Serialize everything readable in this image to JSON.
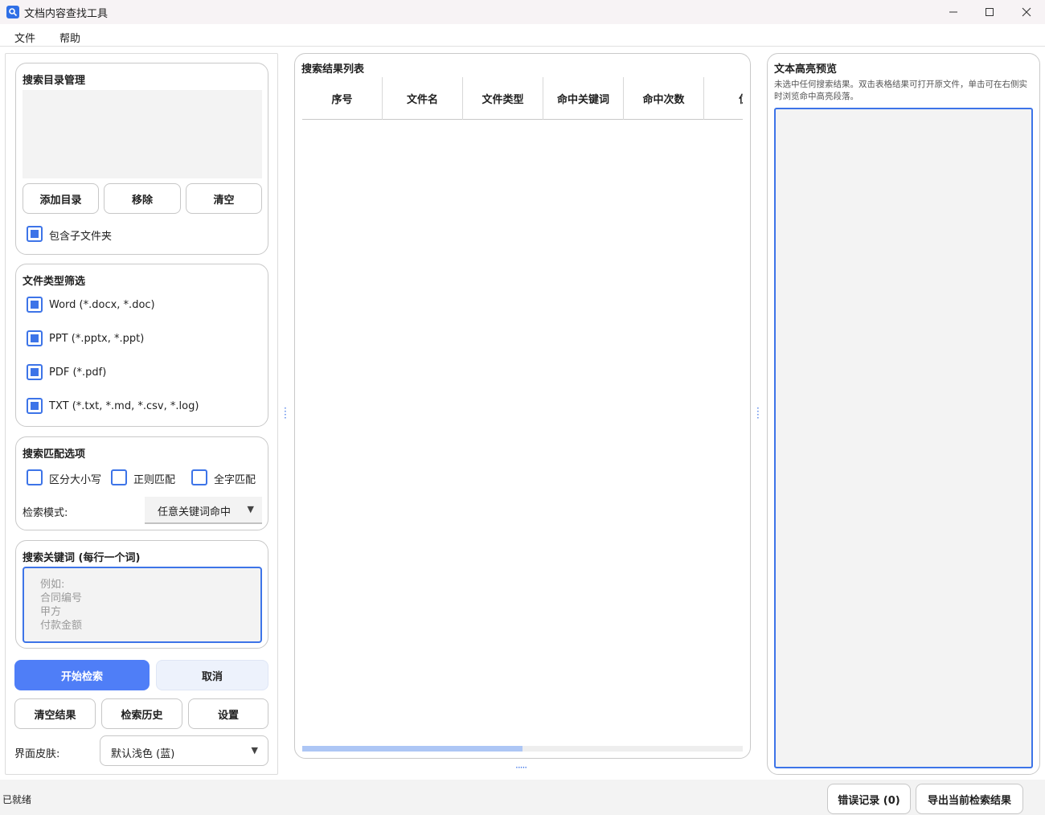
{
  "window": {
    "title": "文档内容查找工具"
  },
  "menu": {
    "file": "文件",
    "help": "帮助"
  },
  "dir_group": {
    "title": "搜索目录管理",
    "add_label": "添加目录",
    "remove_label": "移除",
    "clear_label": "清空",
    "include_sub_label": "包含子文件夹",
    "include_sub_checked": true
  },
  "filetype_group": {
    "title": "文件类型筛选",
    "items": [
      {
        "label": "Word (*.docx, *.doc)",
        "checked": true
      },
      {
        "label": "PPT (*.pptx, *.ppt)",
        "checked": true
      },
      {
        "label": "PDF (*.pdf)",
        "checked": true
      },
      {
        "label": "TXT (*.txt, *.md, *.csv, *.log)",
        "checked": true
      }
    ]
  },
  "match_group": {
    "title": "搜索匹配选项",
    "case_label": "区分大小写",
    "regex_label": "正则匹配",
    "whole_label": "全字匹配",
    "case_checked": false,
    "regex_checked": false,
    "whole_checked": false,
    "mode_label": "检索模式:",
    "mode_value": "任意关键词命中"
  },
  "keyword_group": {
    "title": "搜索关键词 (每行一个词)",
    "placeholder_lines": [
      "例如:",
      "合同编号",
      "甲方",
      "付款金额"
    ]
  },
  "actions": {
    "start_label": "开始检索",
    "cancel_label": "取消",
    "clear_results_label": "清空结果",
    "history_label": "检索历史",
    "settings_label": "设置",
    "skin_label": "界面皮肤:",
    "skin_value": "默认浅色 (蓝)"
  },
  "results": {
    "title": "搜索结果列表",
    "columns": [
      "序号",
      "文件名",
      "文件类型",
      "命中关键词",
      "命中次数",
      "位"
    ],
    "scroll_fraction": 0.5
  },
  "preview": {
    "title": "文本高亮预览",
    "hint": "未选中任何搜索结果。双击表格结果可打开原文件，单击可在右侧实时浏览命中高亮段落。"
  },
  "status": {
    "text": "已就绪",
    "error_log_label": "错误记录 (0)",
    "export_label": "导出当前检索结果"
  },
  "colors": {
    "accent": "#3d74e8",
    "primary_button": "#4f7ef7"
  }
}
